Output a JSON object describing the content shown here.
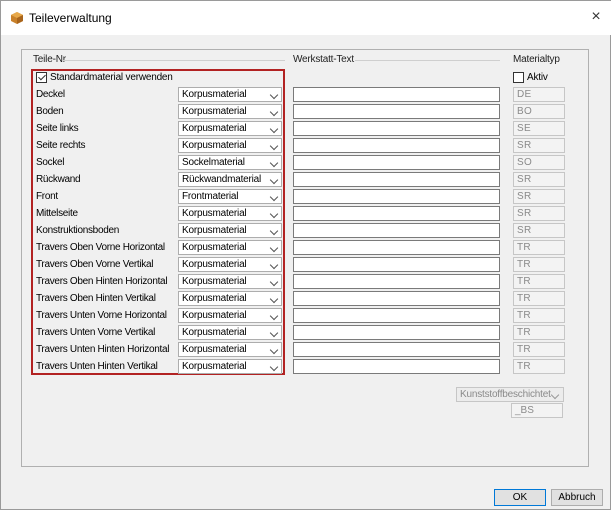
{
  "window": {
    "title": "Teileverwaltung",
    "close_glyph": "×"
  },
  "headers": {
    "part_no": "Teile-Nr",
    "workshop_text": "Werkstatt-Text",
    "material_type": "Materialtyp"
  },
  "standard_material": {
    "label": "Standardmaterial verwenden",
    "checked": true
  },
  "aktiv": {
    "label": "Aktiv",
    "checked": false
  },
  "rows": [
    {
      "label": "Deckel",
      "material": "Korpusmaterial",
      "code": "DE"
    },
    {
      "label": "Boden",
      "material": "Korpusmaterial",
      "code": "BO"
    },
    {
      "label": "Seite links",
      "material": "Korpusmaterial",
      "code": "SE"
    },
    {
      "label": "Seite rechts",
      "material": "Korpusmaterial",
      "code": "SR"
    },
    {
      "label": "Sockel",
      "material": "Sockelmaterial",
      "code": "SO"
    },
    {
      "label": "Rückwand",
      "material": "Rückwandmaterial",
      "code": "SR"
    },
    {
      "label": "Front",
      "material": "Frontmaterial",
      "code": "SR"
    },
    {
      "label": "Mittelseite",
      "material": "Korpusmaterial",
      "code": "SR"
    },
    {
      "label": "Konstruktionsboden",
      "material": "Korpusmaterial",
      "code": "SR"
    },
    {
      "label": "Travers Oben Vorne Horizontal",
      "material": "Korpusmaterial",
      "code": "TR"
    },
    {
      "label": "Travers Oben Vorne Vertikal",
      "material": "Korpusmaterial",
      "code": "TR"
    },
    {
      "label": "Travers Oben Hinten Horizontal",
      "material": "Korpusmaterial",
      "code": "TR"
    },
    {
      "label": "Travers Oben Hinten Vertikal",
      "material": "Korpusmaterial",
      "code": "TR"
    },
    {
      "label": "Travers Unten Vorne Horizontal",
      "material": "Korpusmaterial",
      "code": "TR"
    },
    {
      "label": "Travers Unten Vorne Vertikal",
      "material": "Korpusmaterial",
      "code": "TR"
    },
    {
      "label": "Travers Unten Hinten Horizontal",
      "material": "Korpusmaterial",
      "code": "TR"
    },
    {
      "label": "Travers Unten Hinten Vertikal",
      "material": "Korpusmaterial",
      "code": "TR"
    }
  ],
  "coating": {
    "value": "Kunststoffbeschichtet",
    "suffix": "_BS"
  },
  "buttons": {
    "ok": "OK",
    "cancel": "Abbruch"
  },
  "colors": {
    "highlight": "#b22222",
    "ok_border": "#0078d7"
  }
}
